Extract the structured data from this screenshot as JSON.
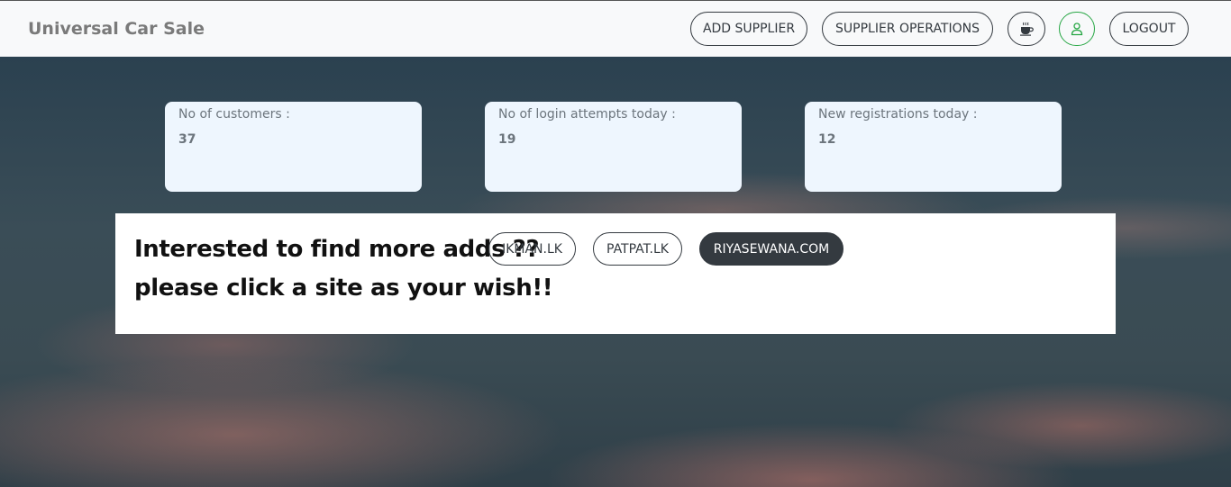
{
  "app": {
    "brand": "Universal Car Sale"
  },
  "nav": {
    "add_supplier": "ADD SUPPLIER",
    "supplier_operations": "SUPPLIER OPERATIONS",
    "logout": "LOGOUT"
  },
  "stats": [
    {
      "label": "No of customers :",
      "value": "37"
    },
    {
      "label": "No of login attempts today :",
      "value": "19"
    },
    {
      "label": "New registrations today :",
      "value": "12"
    }
  ],
  "promo": {
    "line1": "Interested to find more adds ??",
    "line2": "please click a site as your wish!!",
    "sites": [
      "IKMAN.LK",
      "PATPAT.LK",
      "RIYASEWANA.COM"
    ]
  },
  "colors": {
    "accent_green": "#28a745",
    "dark": "#343a40",
    "card_bg": "#eef6fe"
  }
}
